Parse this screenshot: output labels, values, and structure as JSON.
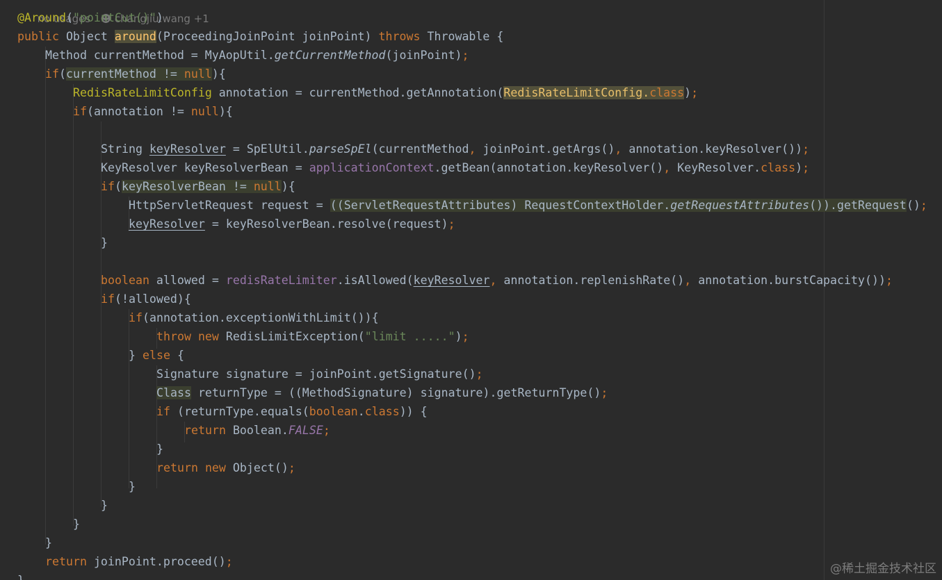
{
  "inlay_hints": {
    "usages": "no usages",
    "author": "changjiu.wang +1"
  },
  "code": {
    "l1_annotation": "@Around",
    "l1_open": "(",
    "l1_string": "\"pointCut()\"",
    "l1_close": ")",
    "l2_public": "public",
    "l2_type": " Object ",
    "l2_method": "around",
    "l2_params": "(ProceedingJoinPoint joinPoint) ",
    "l2_throws": "throws",
    "l2_rest": " Throwable {",
    "l3_a": "Method currentMethod = MyAopUtil.",
    "l3_call": "getCurrentMethod",
    "l3_b": "(joinPoint)",
    "l3_semi": ";",
    "l4_if": "if",
    "l4_open": "(",
    "l4_cond_a": "currentMethod != ",
    "l4_null": "null",
    "l4_close": "){",
    "l5_type": "RedisRateLimitConfig",
    "l5_a": " annotation = currentMethod.getAnnotation(",
    "l5_arg": "RedisRateLimitConfig.",
    "l5_class": "class",
    "l5_b": ")",
    "l5_semi": ";",
    "l6_if": "if",
    "l6_a": "(annotation != ",
    "l6_null": "null",
    "l6_b": "){",
    "l8_a": "String ",
    "l8_var": "keyResolver",
    "l8_b": " = SpElUtil.",
    "l8_call": "parseSpEl",
    "l8_c": "(currentMethod",
    "l8_comma1": ", ",
    "l8_d": "joinPoint.getArgs()",
    "l8_comma2": ", ",
    "l8_e": "annotation.keyResolver())",
    "l8_semi": ";",
    "l9_a": "KeyResolver keyResolverBean = ",
    "l9_field": "applicationContext",
    "l9_b": ".getBean(annotation.keyResolver()",
    "l9_comma": ", ",
    "l9_c": "KeyResolver.",
    "l9_class": "class",
    "l9_d": ")",
    "l9_semi": ";",
    "l10_if": "if",
    "l10_open": "(",
    "l10_cond": "keyResolverBean != ",
    "l10_null": "null",
    "l10_close": "){",
    "l11_a": "HttpServletRequest request = ",
    "l11_b": "((ServletRequestAttributes) RequestContextHolder.",
    "l11_call": "getRequestAttributes",
    "l11_c": "()).getRequest",
    "l11_d": "()",
    "l11_semi": ";",
    "l12_var": "keyResolver",
    "l12_a": " = keyResolverBean.resolve(request)",
    "l12_semi": ";",
    "l13": "}",
    "l15_bool": "boolean",
    "l15_a": " allowed = ",
    "l15_field": "redisRateLimiter",
    "l15_b": ".isAllowed(",
    "l15_var": "keyResolver",
    "l15_comma1": ", ",
    "l15_c": "annotation.replenishRate()",
    "l15_comma2": ", ",
    "l15_d": "annotation.burstCapacity())",
    "l15_semi": ";",
    "l16_if": "if",
    "l16_a": "(!allowed){",
    "l17_if": "if",
    "l17_a": "(annotation.exceptionWithLimit()){",
    "l18_throw": "throw",
    "l18_new": " new",
    "l18_a": " RedisLimitException(",
    "l18_str": "\"limit .....\"",
    "l18_b": ")",
    "l18_semi": ";",
    "l19_a": "} ",
    "l19_else": "else",
    "l19_b": " {",
    "l20_a": "Signature signature = joinPoint.getSignature()",
    "l20_semi": ";",
    "l21_class": "Class",
    "l21_a": " returnType = ((MethodSignature) signature).getReturnType()",
    "l21_semi": ";",
    "l22_if": "if",
    "l22_a": " (returnType.equals(",
    "l22_bool": "boolean",
    "l22_dot": ".",
    "l22_class": "class",
    "l22_b": ")) {",
    "l23_return": "return",
    "l23_a": " Boolean.",
    "l23_const": "FALSE",
    "l23_semi": ";",
    "l24": "}",
    "l25_return": "return",
    "l25_new": " new",
    "l25_a": " Object()",
    "l25_semi": ";",
    "l26": "}",
    "l27": "}",
    "l28": "}",
    "l29": "}",
    "l30_return": "return",
    "l30_a": " joinPoint.proceed()",
    "l30_semi": ";",
    "l31": "}"
  },
  "watermark": "@稀土掘金技术社区",
  "colors": {
    "background": "#2b2b2b",
    "text": "#a9b7c6",
    "keyword": "#cc7832",
    "annotation": "#bbb529",
    "string": "#6a8759",
    "field": "#9876aa"
  }
}
